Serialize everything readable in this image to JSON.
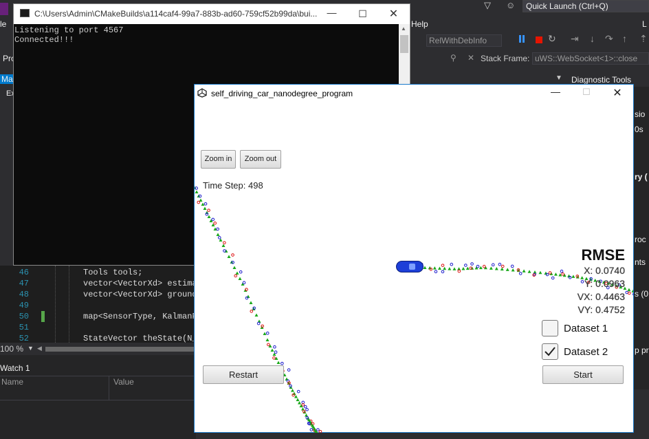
{
  "vs": {
    "quick_launch": "Quick Launch (Ctrl+Q)",
    "menu_help": "Help",
    "config": "RelWithDebInfo",
    "stack_frame_label": "Stack Frame:",
    "stack_frame_value": "uWS::WebSocket<1>::close",
    "diagnostic_tools": "Diagnostic Tools",
    "zoom_level": "100 %",
    "watch_title": "Watch 1",
    "watch_col_name": "Name",
    "watch_col_value": "Value",
    "code_lines": [
      {
        "num": "46",
        "text": "Tools tools;"
      },
      {
        "num": "47",
        "text": "vector<VectorXd> estima"
      },
      {
        "num": "48",
        "text": "vector<VectorXd> ground"
      },
      {
        "num": "49",
        "text": ""
      },
      {
        "num": "50",
        "text": "map<SensorType, KalmanF"
      },
      {
        "num": "51",
        "text": ""
      },
      {
        "num": "52",
        "text": "StateVector theState(N_"
      }
    ]
  },
  "console": {
    "title": "C:\\Users\\Admin\\CMakeBuilds\\a114caf4-99a7-883b-ad60-759cf52b99da\\bui...",
    "lines": [
      "Listening to port 4567",
      "Connected!!!"
    ]
  },
  "sim": {
    "title": "self_driving_car_nanodegree_program",
    "zoom_in": "Zoom in",
    "zoom_out": "Zoom out",
    "time_step": "Time Step: 498",
    "rmse_title": "RMSE",
    "rmse": {
      "x": "X: 0.0740",
      "y": "Y: 0.0963",
      "vx": "VX: 0.4463",
      "vy": "VY: 0.4752"
    },
    "dataset1": "Dataset 1",
    "dataset2": "Dataset 2",
    "dataset2_checked": true,
    "restart": "Restart",
    "start": "Start",
    "colors": {
      "track": "#1aa81a",
      "radar": "#1a1acc",
      "lidar": "#d11",
      "car": "#1d3fd8"
    }
  }
}
